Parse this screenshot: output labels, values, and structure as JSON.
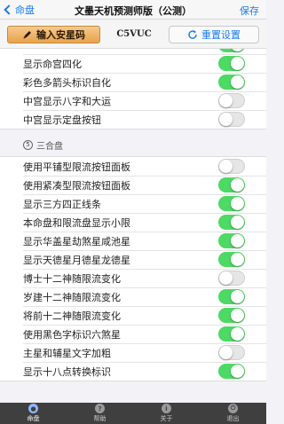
{
  "nav": {
    "back_label": "命盘",
    "title": "文墨天机预测师版（公测）",
    "save_label": "保存"
  },
  "toolbar": {
    "import_label": "输入安星码",
    "code": "C5VUC",
    "reset_label": "重置设置"
  },
  "group1": {
    "rows": [
      {
        "label": "显示命宫四化",
        "on": true
      },
      {
        "label": "彩色多箭头标识自化",
        "on": true
      },
      {
        "label": "中宫显示八字和大运",
        "on": false
      },
      {
        "label": "中宫显示定盘按钮",
        "on": false
      }
    ]
  },
  "section2": {
    "number": "5",
    "title": "三合盘"
  },
  "group2": {
    "rows": [
      {
        "label": "使用平铺型限流按钮面板",
        "on": false
      },
      {
        "label": "使用紧凑型限流按钮面板",
        "on": true
      },
      {
        "label": "显示三方四正线条",
        "on": true
      },
      {
        "label": "本命盘和限流盘显示小限",
        "on": true
      },
      {
        "label": "显示华盖星劫煞星咸池星",
        "on": true
      },
      {
        "label": "显示天德星月德星龙德星",
        "on": true
      },
      {
        "label": "博士十二神随限流变化",
        "on": false
      },
      {
        "label": "岁建十二神随限流变化",
        "on": true
      },
      {
        "label": "将前十二神随限流变化",
        "on": true
      },
      {
        "label": "使用黑色字标识六煞星",
        "on": true
      },
      {
        "label": "主星和辅星文字加粗",
        "on": false
      },
      {
        "label": "显示十八点转换标识",
        "on": true
      }
    ]
  },
  "tabs": [
    {
      "label": "命盘",
      "icon": "chart-disc-icon",
      "active": true
    },
    {
      "label": "帮助",
      "icon": "help-icon",
      "active": false
    },
    {
      "label": "关于",
      "icon": "info-icon",
      "active": false
    },
    {
      "label": "退出",
      "icon": "exit-icon",
      "active": false
    }
  ],
  "colors": {
    "accent": "#1a7cf2",
    "toggle_on": "#4cd964",
    "import_button": "#e8a24b",
    "tabbar": "#3f3f3f"
  }
}
